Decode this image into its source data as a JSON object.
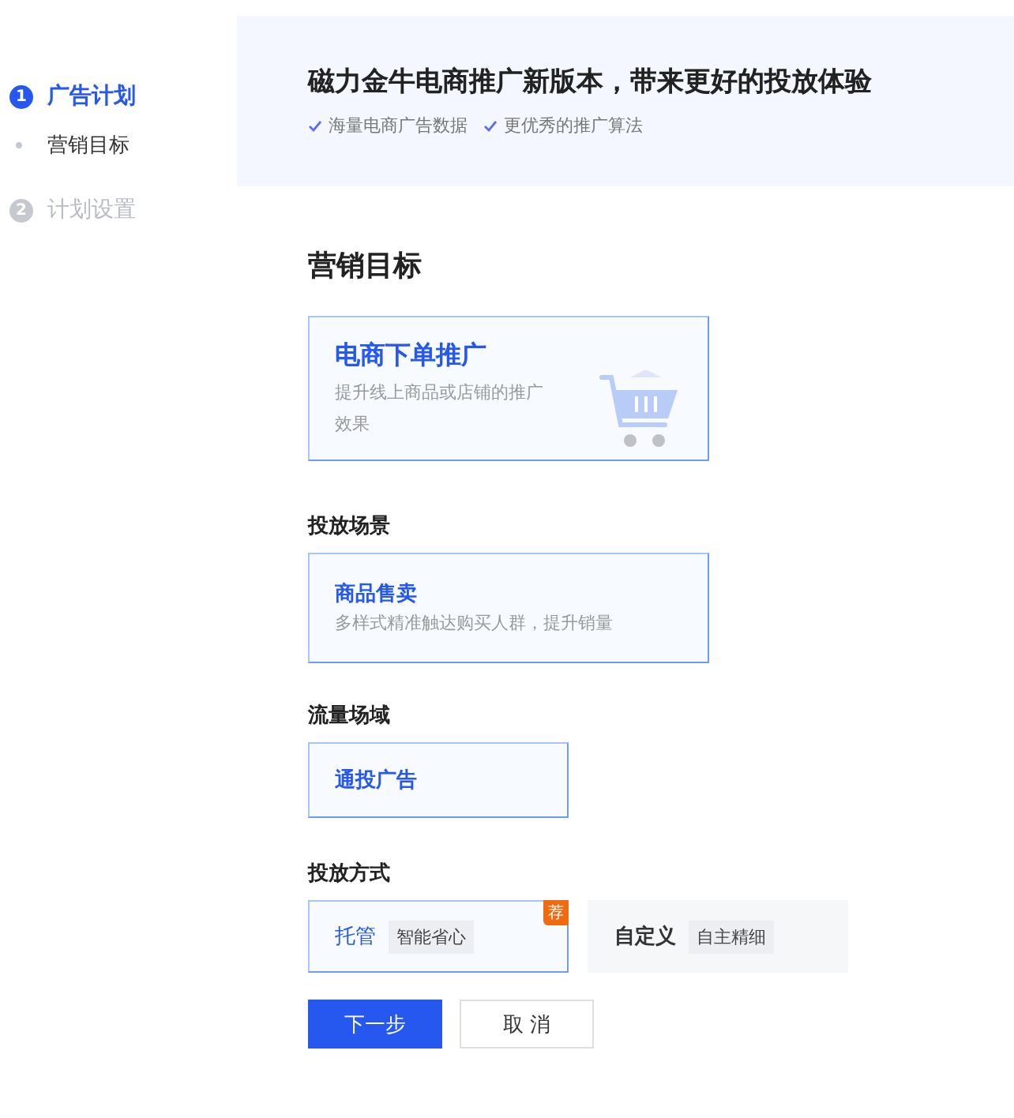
{
  "sidebar": {
    "steps": [
      {
        "number": "1",
        "label": "广告计划",
        "selected": true,
        "children": [
          {
            "label": "营销目标"
          }
        ]
      },
      {
        "number": "2",
        "label": "计划设置",
        "selected": false
      }
    ]
  },
  "banner": {
    "title": "磁力金牛电商推广新版本，带来更好的投放体验",
    "features": [
      "海量电商广告数据",
      "更优秀的推广算法"
    ]
  },
  "sections": [
    {
      "kind": "goal",
      "heading": "营销目标",
      "options": [
        {
          "title": "电商下单推广",
          "description": "提升线上商品或店铺的推广效果",
          "selected": true
        }
      ]
    },
    {
      "kind": "scene",
      "heading": "投放场景",
      "options": [
        {
          "title": "商品售卖",
          "description": "多样式精准触达购买人群，提升销量",
          "selected": true
        }
      ]
    },
    {
      "kind": "traffic",
      "heading": "流量场域",
      "options": [
        {
          "title": "通投广告",
          "selected": true
        }
      ]
    },
    {
      "kind": "method",
      "heading": "投放方式",
      "options": [
        {
          "title": "托管",
          "tag": "智能省心",
          "badge": "荐",
          "selected": true
        },
        {
          "title": "自定义",
          "tag": "自主精细",
          "selected": false
        }
      ]
    }
  ],
  "buttons": [
    {
      "label": "下一步",
      "kind": "primary"
    },
    {
      "label": "取 消",
      "kind": "default"
    }
  ]
}
